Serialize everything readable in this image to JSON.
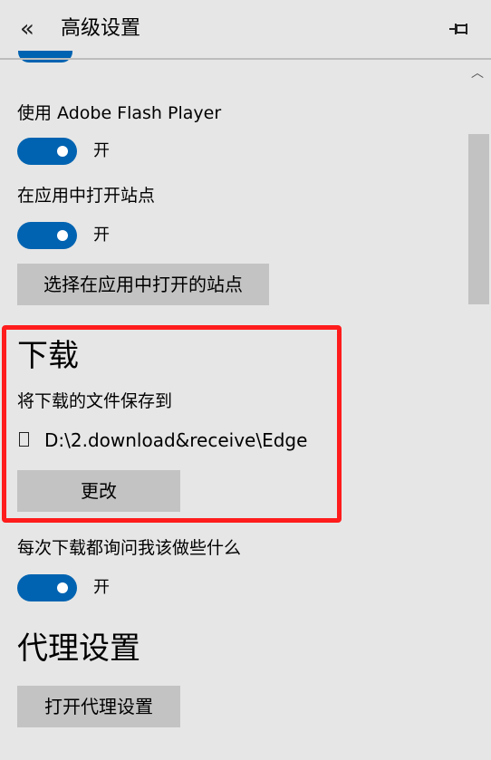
{
  "header": {
    "title": "高级设置",
    "back_icon": "double-chevron-left-icon",
    "pin_icon": "pin-icon"
  },
  "flash": {
    "label": "使用 Adobe Flash Player",
    "state": "开"
  },
  "open_sites_in_apps": {
    "label": "在应用中打开站点",
    "state": "开",
    "button": "选择在应用中打开的站点"
  },
  "downloads": {
    "title": "下载",
    "save_label": "将下载的文件保存到",
    "path": "D:\\2.download&receive\\Edge",
    "change_button": "更改",
    "ask_label": "每次下载都询问我该做些什么",
    "ask_state": "开"
  },
  "proxy": {
    "title": "代理设置",
    "button": "打开代理设置"
  },
  "colors": {
    "accent": "#0063b1",
    "highlight": "#ff1c1c",
    "background": "#e6e6e6",
    "button": "#c3c3c3"
  }
}
